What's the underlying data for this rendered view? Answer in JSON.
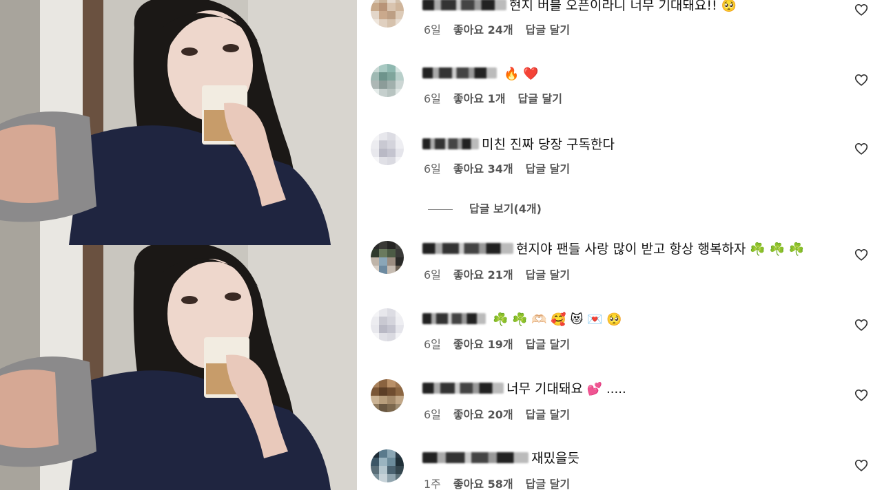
{
  "heart_icon": "heart-outline-icon",
  "photos": [
    {
      "alt": "",
      "index": 1
    },
    {
      "alt": "",
      "index": 2
    }
  ],
  "comments": [
    {
      "text": "현지 버블 오픈이라니 너무 기대돼요!!",
      "emoji": "🥺",
      "time": "6일",
      "likes": "좋아요 24개",
      "reply": "답글 달기"
    },
    {
      "text": "",
      "emoji": "🔥 ❤️",
      "time": "6일",
      "likes": "좋아요 1개",
      "reply": "답글 달기"
    },
    {
      "text": "미친 진짜 당장 구독한다",
      "emoji": "",
      "time": "6일",
      "likes": "좋아요 34개",
      "reply": "답글 달기"
    },
    {
      "text": "현지야 팬들 사랑 많이 받고 항상 행복하자",
      "emoji": "☘️ ☘️ ☘️",
      "time": "6일",
      "likes": "좋아요 21개",
      "reply": "답글 달기"
    },
    {
      "text": "",
      "emoji": "☘️ ☘️ 🫶🏻 🥰 😻 💌 🥺",
      "time": "6일",
      "likes": "좋아요 19개",
      "reply": "답글 달기"
    },
    {
      "text": "너무 기대돼요",
      "emoji": "💕 .....",
      "time": "6일",
      "likes": "좋아요 20개",
      "reply": "답글 달기"
    },
    {
      "text": "재밌을듯",
      "emoji": "",
      "time": "1주",
      "likes": "좋아요 58개",
      "reply": "답글 달기"
    }
  ],
  "view_replies": "답글 보기(4개)"
}
